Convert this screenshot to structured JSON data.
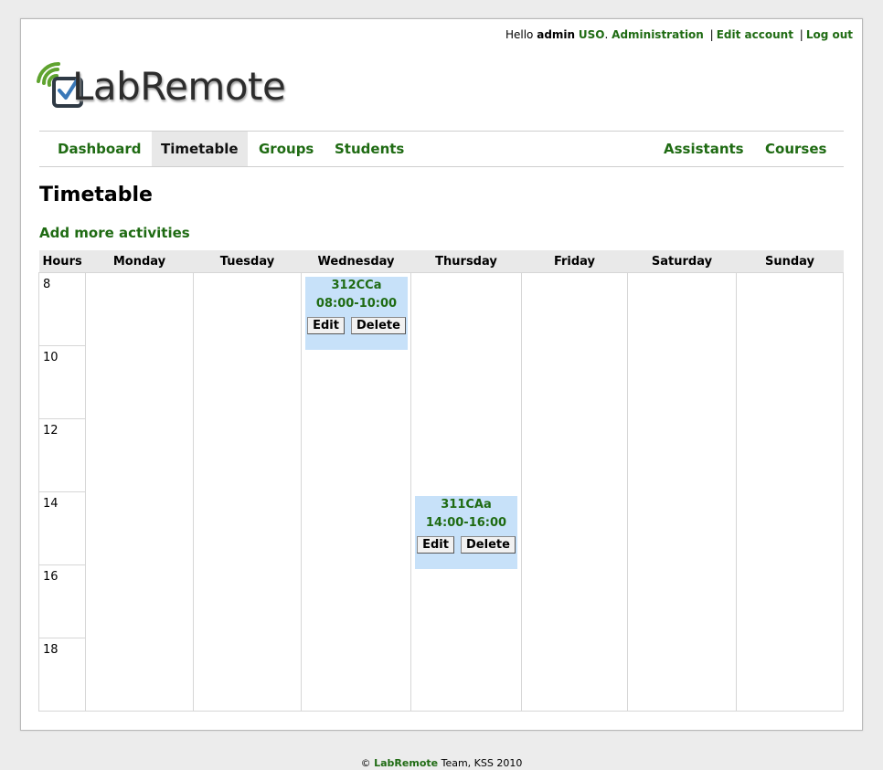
{
  "userbar": {
    "hello": "Hello",
    "username": "admin",
    "course": "USO",
    "course_suffix": ".",
    "administration": "Administration",
    "separator": "|",
    "edit_account": "Edit account",
    "logout": "Log out"
  },
  "logo": {
    "text": "LabRemote",
    "icon": "wifi-checkbox-icon"
  },
  "nav": {
    "left": [
      "Dashboard",
      "Timetable",
      "Groups",
      "Students"
    ],
    "right": [
      "Assistants",
      "Courses"
    ],
    "active": "Timetable"
  },
  "page_title": "Timetable",
  "add_link": "Add more activities",
  "timetable": {
    "headers": [
      "Hours",
      "Monday",
      "Tuesday",
      "Wednesday",
      "Thursday",
      "Friday",
      "Saturday",
      "Sunday"
    ],
    "hours": [
      "8",
      "10",
      "12",
      "14",
      "16",
      "18"
    ],
    "activities": [
      {
        "name": "312CCa",
        "time": "08:00-10:00",
        "day": "Wednesday",
        "start_hour": "8",
        "edit": "Edit",
        "delete": "Delete"
      },
      {
        "name": "311CAa",
        "time": "14:00-16:00",
        "day": "Thursday",
        "start_hour": "14",
        "edit": "Edit",
        "delete": "Delete"
      }
    ]
  },
  "footer": {
    "copyright": "©",
    "brand": "LabRemote",
    "rest": "Team, KSS 2010"
  },
  "colors": {
    "link": "#1f6b13",
    "activity_bg": "#c7e1f9",
    "header_bg": "#e9e9e9",
    "page_bg": "#ececec"
  }
}
